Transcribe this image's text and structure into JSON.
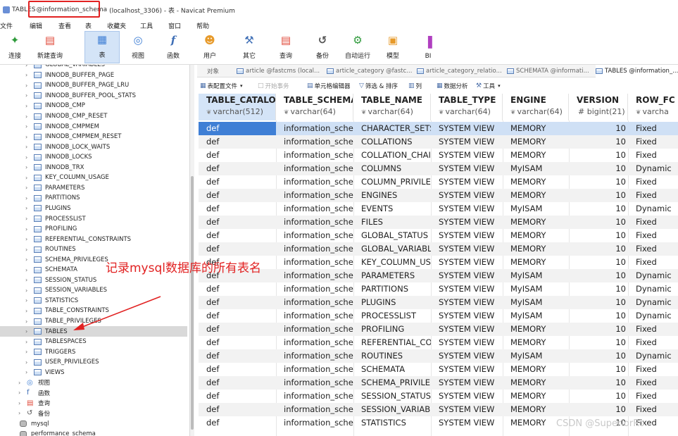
{
  "window": {
    "title_prefix": "TABLES",
    "title_highlight": "@information_schema",
    "title_suffix": "(localhost_3306) - 表 - Navicat Premium"
  },
  "menu": [
    "文件",
    "编辑",
    "查看",
    "表",
    "收藏夹",
    "工具",
    "窗口",
    "帮助"
  ],
  "toolbar": {
    "connect": "连接",
    "new_query": "新建查询",
    "table": "表",
    "view": "视图",
    "function": "函数",
    "user": "用户",
    "other": "其它",
    "query": "查询",
    "backup": "备份",
    "automation": "自动运行",
    "model": "模型",
    "bi": "BI"
  },
  "sidebar": {
    "tables": [
      "GLOBAL_VARIABLES",
      "INNODB_BUFFER_PAGE",
      "INNODB_BUFFER_PAGE_LRU",
      "INNODB_BUFFER_POOL_STATS",
      "INNODB_CMP",
      "INNODB_CMP_RESET",
      "INNODB_CMPMEM",
      "INNODB_CMPMEM_RESET",
      "INNODB_LOCK_WAITS",
      "INNODB_LOCKS",
      "INNODB_TRX",
      "KEY_COLUMN_USAGE",
      "PARAMETERS",
      "PARTITIONS",
      "PLUGINS",
      "PROCESSLIST",
      "PROFILING",
      "REFERENTIAL_CONSTRAINTS",
      "ROUTINES",
      "SCHEMA_PRIVILEGES",
      "SCHEMATA",
      "SESSION_STATUS",
      "SESSION_VARIABLES",
      "STATISTICS",
      "TABLE_CONSTRAINTS",
      "TABLE_PRIVILEGES",
      "TABLES",
      "TABLESPACES",
      "TRIGGERS",
      "USER_PRIVILEGES",
      "VIEWS"
    ],
    "selected_table": "TABLES",
    "groups": [
      "视图",
      "函数",
      "查询",
      "备份"
    ],
    "databases": [
      "mysql",
      "performance_schema"
    ]
  },
  "tabs": [
    "对象",
    "article @fastcms (local...",
    "article_category @fastc...",
    "article_category_relatio...",
    "SCHEMATA @informati...",
    "TABLES @information_..."
  ],
  "subtoolbar": {
    "table_config": "表配置文件",
    "begin_tx": "开始事务",
    "cell_editor": "单元格编辑器",
    "filter_sort": "筛选 & 排序",
    "columns": "列",
    "data_analysis": "数据分析",
    "tools": "工具"
  },
  "columns": [
    {
      "name": "TABLE_CATALOG",
      "type": "varchar(512)",
      "type_icon": "text-type-icon"
    },
    {
      "name": "TABLE_SCHEMA",
      "type": "varchar(64)",
      "type_icon": "text-type-icon"
    },
    {
      "name": "TABLE_NAME",
      "type": "varchar(64)",
      "type_icon": "text-type-icon"
    },
    {
      "name": "TABLE_TYPE",
      "type": "varchar(64)",
      "type_icon": "text-type-icon"
    },
    {
      "name": "ENGINE",
      "type": "varchar(64)",
      "type_icon": "text-type-icon"
    },
    {
      "name": "VERSION",
      "type": "# bigint(21)",
      "type_icon": "number-type-icon"
    },
    {
      "name": "ROW_FC",
      "type": "varcha",
      "type_icon": "text-type-icon"
    }
  ],
  "rows": [
    [
      "def",
      "information_scher",
      "CHARACTER_SETS",
      "SYSTEM VIEW",
      "MEMORY",
      "10",
      "Fixed"
    ],
    [
      "def",
      "information_scher",
      "COLLATIONS",
      "SYSTEM VIEW",
      "MEMORY",
      "10",
      "Fixed"
    ],
    [
      "def",
      "information_scher",
      "COLLATION_CHAI",
      "SYSTEM VIEW",
      "MEMORY",
      "10",
      "Fixed"
    ],
    [
      "def",
      "information_scher",
      "COLUMNS",
      "SYSTEM VIEW",
      "MyISAM",
      "10",
      "Dynamic"
    ],
    [
      "def",
      "information_scher",
      "COLUMN_PRIVILE",
      "SYSTEM VIEW",
      "MEMORY",
      "10",
      "Fixed"
    ],
    [
      "def",
      "information_scher",
      "ENGINES",
      "SYSTEM VIEW",
      "MEMORY",
      "10",
      "Fixed"
    ],
    [
      "def",
      "information_scher",
      "EVENTS",
      "SYSTEM VIEW",
      "MyISAM",
      "10",
      "Dynamic"
    ],
    [
      "def",
      "information_scher",
      "FILES",
      "SYSTEM VIEW",
      "MEMORY",
      "10",
      "Fixed"
    ],
    [
      "def",
      "information_scher",
      "GLOBAL_STATUS",
      "SYSTEM VIEW",
      "MEMORY",
      "10",
      "Fixed"
    ],
    [
      "def",
      "information_scher",
      "GLOBAL_VARIABL",
      "SYSTEM VIEW",
      "MEMORY",
      "10",
      "Fixed"
    ],
    [
      "def",
      "information_scher",
      "KEY_COLUMN_US",
      "SYSTEM VIEW",
      "MEMORY",
      "10",
      "Fixed"
    ],
    [
      "def",
      "information_scher",
      "PARAMETERS",
      "SYSTEM VIEW",
      "MyISAM",
      "10",
      "Dynamic"
    ],
    [
      "def",
      "information_scher",
      "PARTITIONS",
      "SYSTEM VIEW",
      "MyISAM",
      "10",
      "Dynamic"
    ],
    [
      "def",
      "information_scher",
      "PLUGINS",
      "SYSTEM VIEW",
      "MyISAM",
      "10",
      "Dynamic"
    ],
    [
      "def",
      "information_scher",
      "PROCESSLIST",
      "SYSTEM VIEW",
      "MyISAM",
      "10",
      "Dynamic"
    ],
    [
      "def",
      "information_scher",
      "PROFILING",
      "SYSTEM VIEW",
      "MEMORY",
      "10",
      "Fixed"
    ],
    [
      "def",
      "information_scher",
      "REFERENTIAL_COI",
      "SYSTEM VIEW",
      "MEMORY",
      "10",
      "Fixed"
    ],
    [
      "def",
      "information_scher",
      "ROUTINES",
      "SYSTEM VIEW",
      "MyISAM",
      "10",
      "Dynamic"
    ],
    [
      "def",
      "information_scher",
      "SCHEMATA",
      "SYSTEM VIEW",
      "MEMORY",
      "10",
      "Fixed"
    ],
    [
      "def",
      "information_scher",
      "SCHEMA_PRIVILE(",
      "SYSTEM VIEW",
      "MEMORY",
      "10",
      "Fixed"
    ],
    [
      "def",
      "information_scher",
      "SESSION_STATUS",
      "SYSTEM VIEW",
      "MEMORY",
      "10",
      "Fixed"
    ],
    [
      "def",
      "information_scher",
      "SESSION_VARIABI",
      "SYSTEM VIEW",
      "MEMORY",
      "10",
      "Fixed"
    ],
    [
      "def",
      "information_scher",
      "STATISTICS",
      "SYSTEM VIEW",
      "MEMORY",
      "10",
      "Fixed"
    ]
  ],
  "annotation": {
    "text": "记录mysql数据库的所有表名",
    "color": "#e12121"
  },
  "watermark": "CSDN @SuperiorRo",
  "colors": {
    "selection": "#3f7fd5",
    "row_selected": "#cfe0f5",
    "header_selected": "#d4e4f7",
    "annotation": "#e12121"
  }
}
